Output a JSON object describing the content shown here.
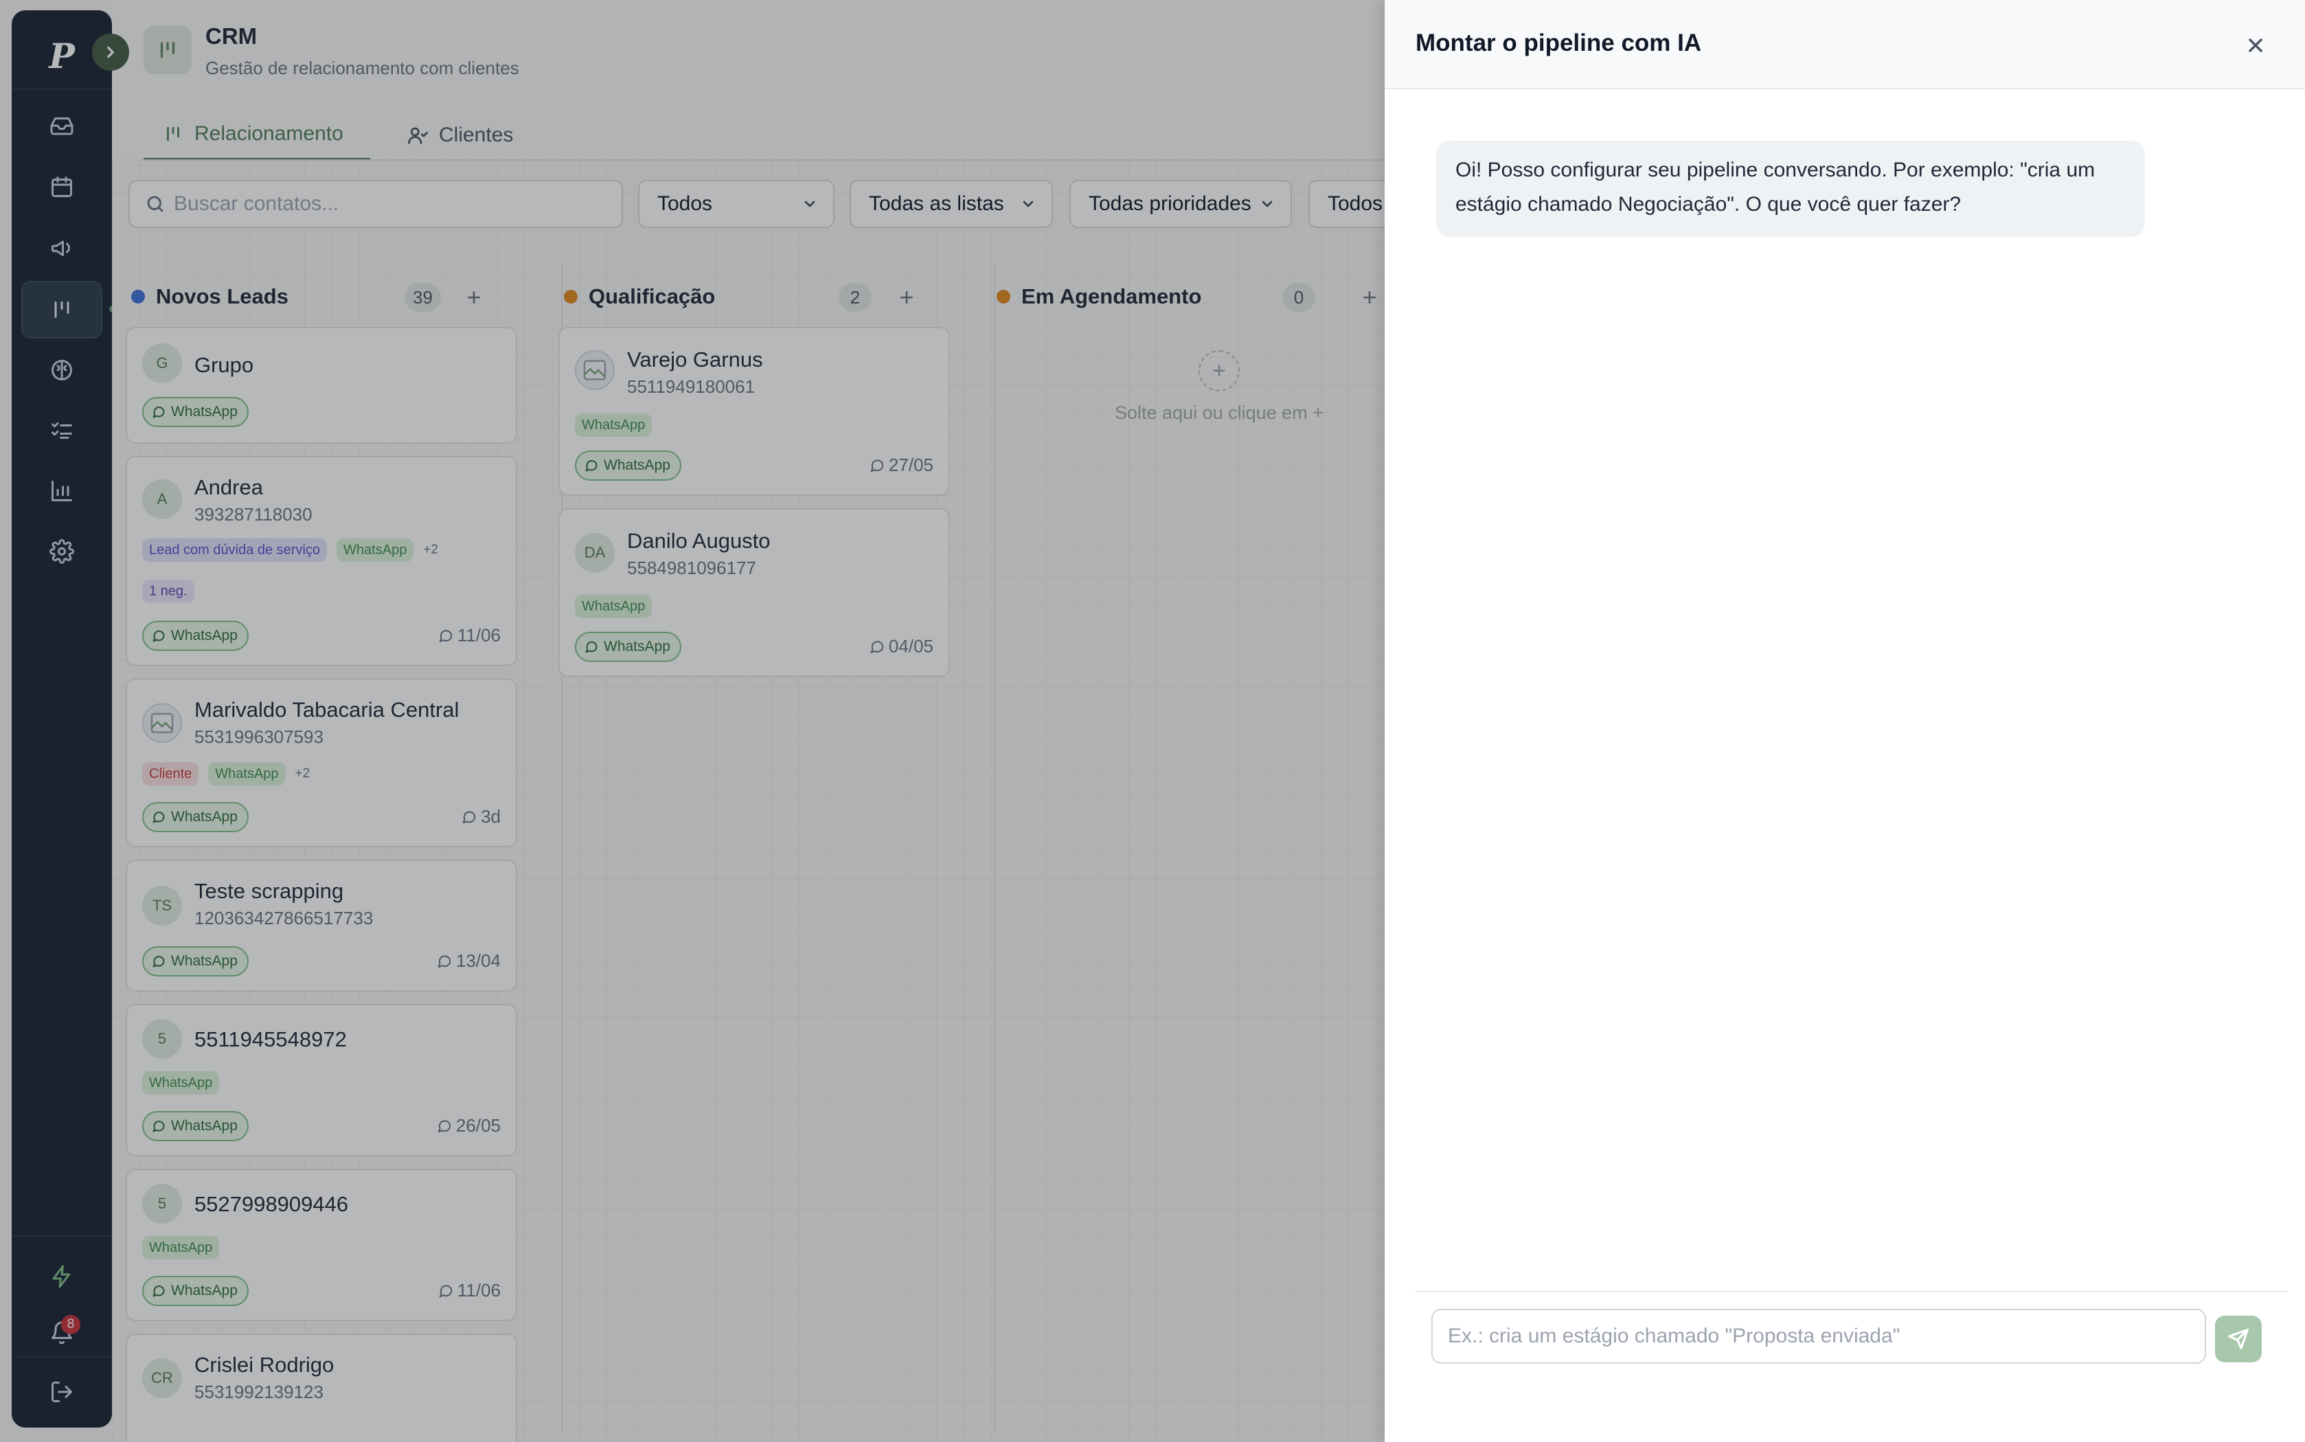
{
  "app": {
    "logo_letter": "P",
    "notifications_count": "8"
  },
  "nav": {
    "items": [
      {
        "icon": "inbox-icon"
      },
      {
        "icon": "calendar-icon"
      },
      {
        "icon": "megaphone-icon"
      },
      {
        "icon": "kanban-icon",
        "active": true
      },
      {
        "icon": "brain-icon"
      },
      {
        "icon": "checklist-icon"
      },
      {
        "icon": "bar-chart-icon"
      },
      {
        "icon": "gear-icon"
      }
    ],
    "bottom": [
      {
        "icon": "lightning-icon"
      },
      {
        "icon": "bell-icon"
      },
      {
        "icon": "logout-icon"
      }
    ]
  },
  "header": {
    "title": "CRM",
    "subtitle": "Gestão de relacionamento com clientes",
    "tabs": [
      {
        "label": "Relacionamento",
        "active": true
      },
      {
        "label": "Clientes",
        "active": false
      }
    ]
  },
  "filters": {
    "search_placeholder": "Buscar contatos...",
    "status": "Todos",
    "lists": "Todas as listas",
    "priorities": "Todas prioridades",
    "other": "Todos"
  },
  "columns": [
    {
      "title": "Novos Leads",
      "count": "39",
      "color": "#3b6fd8",
      "cards": [
        {
          "initials": "G",
          "name": "Grupo",
          "phone": "",
          "channel": "WhatsApp",
          "date": ""
        },
        {
          "initials": "A",
          "name": "Andrea",
          "phone": "393287118030",
          "tags": [
            "Lead com dúvida de serviço",
            "WhatsApp"
          ],
          "more": "+2",
          "extra": "1 neg.",
          "channel": "WhatsApp",
          "date": "11/06"
        },
        {
          "initials": "",
          "name": "Marivaldo Tabacaria Central",
          "phone": "5531996307593",
          "tags": [
            "Cliente",
            "WhatsApp"
          ],
          "more": "+2",
          "channel": "WhatsApp",
          "date": "3d"
        },
        {
          "initials": "TS",
          "name": "Teste scrapping",
          "phone": "120363427866517733",
          "channel": "WhatsApp",
          "date": "13/04"
        },
        {
          "initials": "5",
          "name": "5511945548972",
          "tags": [
            "WhatsApp"
          ],
          "channel": "WhatsApp",
          "date": "26/05"
        },
        {
          "initials": "5",
          "name": "5527998909446",
          "tags": [
            "WhatsApp"
          ],
          "channel": "WhatsApp",
          "date": "11/06"
        },
        {
          "initials": "CR",
          "name": "Crislei Rodrigo",
          "phone": "5531992139123"
        }
      ]
    },
    {
      "title": "Qualificação",
      "count": "2",
      "color": "#e08a1e",
      "cards": [
        {
          "initials": "",
          "name": "Varejo Garnus",
          "phone": "5511949180061",
          "tags": [
            "WhatsApp"
          ],
          "channel": "WhatsApp",
          "date": "27/05"
        },
        {
          "initials": "DA",
          "name": "Danilo Augusto",
          "phone": "5584981096177",
          "tags": [
            "WhatsApp"
          ],
          "channel": "WhatsApp",
          "date": "04/05"
        }
      ]
    },
    {
      "title": "Em Agendamento",
      "count": "0",
      "color": "#e08a1e",
      "empty_text": "Solte aqui ou clique em +"
    }
  ],
  "panel": {
    "title": "Montar o pipeline com IA",
    "message": "Oi! Posso configurar seu pipeline conversando. Por exemplo: \"cria um estágio chamado Negociação\". O que você quer fazer?",
    "input_placeholder": "Ex.: cria um estágio chamado \"Proposta enviada\""
  }
}
